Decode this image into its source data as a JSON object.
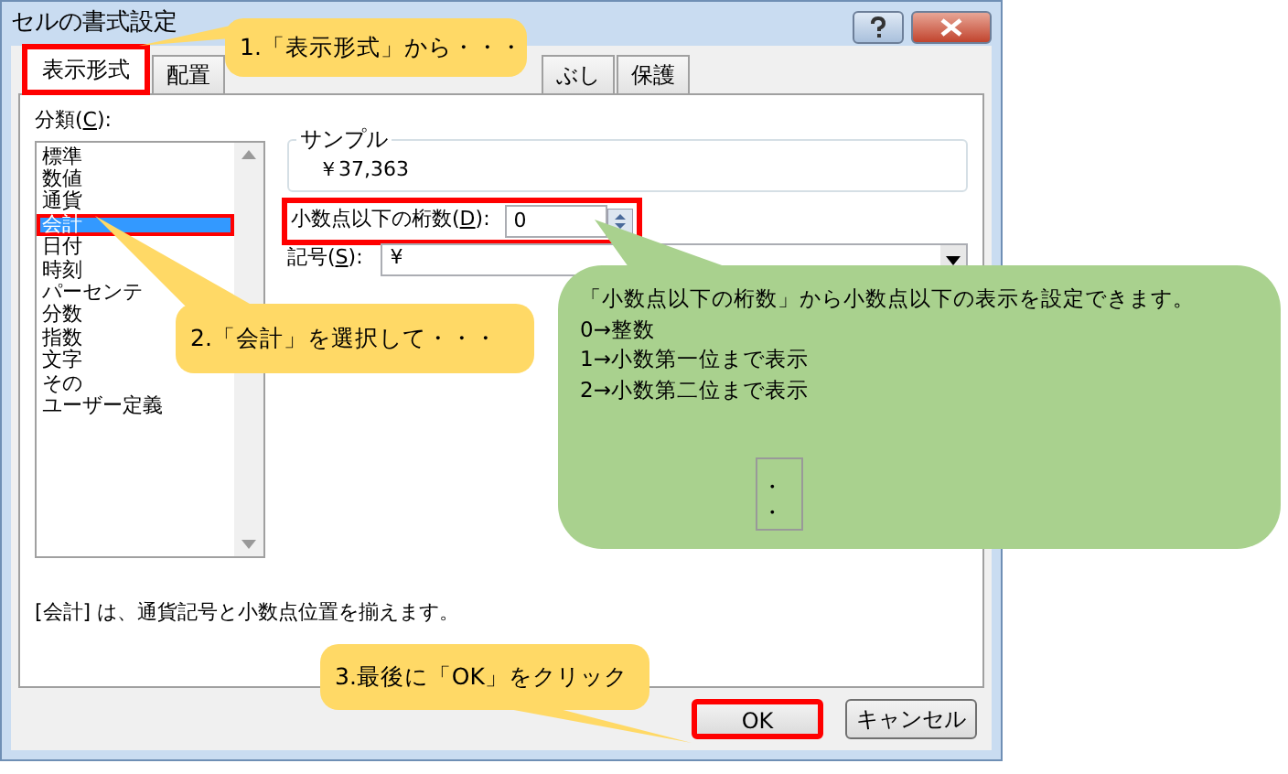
{
  "window": {
    "title": "セルの書式設定"
  },
  "tabs": [
    {
      "label": "表示形式",
      "selected": true,
      "highlighted": true
    },
    {
      "label": "配置",
      "selected": false,
      "highlighted": false
    },
    {
      "label": "ぶし",
      "selected": false,
      "highlighted": false
    },
    {
      "label": "保護",
      "selected": false,
      "highlighted": false
    }
  ],
  "category": {
    "label_before": "分類(",
    "accel": "C",
    "label_after": "):",
    "items": [
      {
        "label": "標準",
        "selected": false,
        "highlighted": false
      },
      {
        "label": "数値",
        "selected": false,
        "highlighted": false
      },
      {
        "label": "通貨",
        "selected": false,
        "highlighted": false
      },
      {
        "label": "会計",
        "selected": true,
        "highlighted": true
      },
      {
        "label": "日付",
        "selected": false,
        "highlighted": false
      },
      {
        "label": "時刻",
        "selected": false,
        "highlighted": false
      },
      {
        "label": "パーセンテ",
        "selected": false,
        "highlighted": false
      },
      {
        "label": "分数",
        "selected": false,
        "highlighted": false
      },
      {
        "label": "指数",
        "selected": false,
        "highlighted": false
      },
      {
        "label": "文字",
        "selected": false,
        "highlighted": false
      },
      {
        "label": "その",
        "selected": false,
        "highlighted": false
      },
      {
        "label": "ユーザー定義",
        "selected": false,
        "highlighted": false
      }
    ]
  },
  "sample": {
    "legend": "サンプル",
    "value": "￥37,363"
  },
  "decimals": {
    "label_before": "小数点以下の桁数(",
    "accel": "D",
    "label_after": "):",
    "value": "0",
    "highlighted": true
  },
  "symbol": {
    "label_before": "記号(",
    "accel": "S",
    "label_after": "):",
    "value": "¥"
  },
  "description": "[会計] は、通貨記号と小数点位置を揃えます。",
  "buttons": [
    {
      "label": "OK",
      "highlighted": true
    },
    {
      "label": "キャンセル",
      "highlighted": false
    }
  ],
  "callouts": [
    {
      "kind": "yellow",
      "text": "1.「表示形式」から・・・"
    },
    {
      "kind": "yellow",
      "text": "2.「会計」を選択して・・・"
    },
    {
      "kind": "yellow",
      "text": "3.最後に「OK」をクリック"
    },
    {
      "kind": "green",
      "lines": [
        "「小数点以下の桁数」から小数点以下の表示を設定できます。",
        "0→整数",
        "1→小数第一位まで表示",
        "2→小数第二位まで表示"
      ],
      "continuation": [
        "・",
        "・"
      ]
    }
  ]
}
